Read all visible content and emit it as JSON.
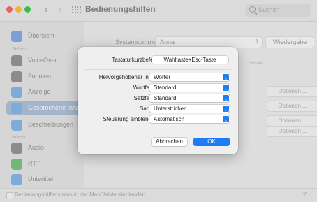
{
  "window": {
    "title": "Bedienungshilfen",
    "search_placeholder": "Suchen"
  },
  "sidebar": {
    "sections": [
      "Sehen",
      "Hören"
    ],
    "items": [
      {
        "label": "Übersicht",
        "icon": "overview-icon",
        "color": "#7da6e0"
      },
      {
        "label": "VoiceOver",
        "icon": "voiceover-icon",
        "color": "#8f8f8f"
      },
      {
        "label": "Zoomen",
        "icon": "zoom-icon",
        "color": "#8f8f8f"
      },
      {
        "label": "Anzeige",
        "icon": "display-icon",
        "color": "#7eb3e8"
      },
      {
        "label": "Gesprochene Inhalte",
        "icon": "spoken-content-icon",
        "color": "#7eb3e8",
        "selected": true
      },
      {
        "label": "Beschreibungen",
        "icon": "descriptions-icon",
        "color": "#7eb3e8"
      },
      {
        "label": "Audio",
        "icon": "audio-icon",
        "color": "#8f8f8f"
      },
      {
        "label": "RTT",
        "icon": "rtt-icon",
        "color": "#72c07a"
      },
      {
        "label": "Untertitel",
        "icon": "subtitles-icon",
        "color": "#7eb3e8"
      }
    ]
  },
  "main": {
    "system_voice_label": "Systemstimme:",
    "system_voice_value": "Anna",
    "play_button": "Wiedergabe",
    "speed_label": "Schnell",
    "options_button": "Optionen ..."
  },
  "footer": {
    "checkbox_label": "Bedienungshilfenstatus in der Menüleiste einblenden",
    "help": "?"
  },
  "sheet": {
    "shortcut_label": "Tastaturkurzbefehl:",
    "shortcut_value": "Wahltaste+Esc-Taste",
    "rows": [
      {
        "label": "Hervorgehobener Inhalt:",
        "value": "Wörter"
      },
      {
        "label": "Wortfarbe:",
        "value": "Standard"
      },
      {
        "label": "Satzfarbe:",
        "value": "Standard"
      },
      {
        "label": "Satzstil:",
        "value": "Unterstrichen"
      },
      {
        "label": "Steuerung einblenden:",
        "value": "Automatisch"
      }
    ],
    "cancel_button": "Abbrechen",
    "ok_button": "OK"
  },
  "colors": {
    "accent": "#1f7cf2",
    "selection": "#a9bcd6"
  }
}
